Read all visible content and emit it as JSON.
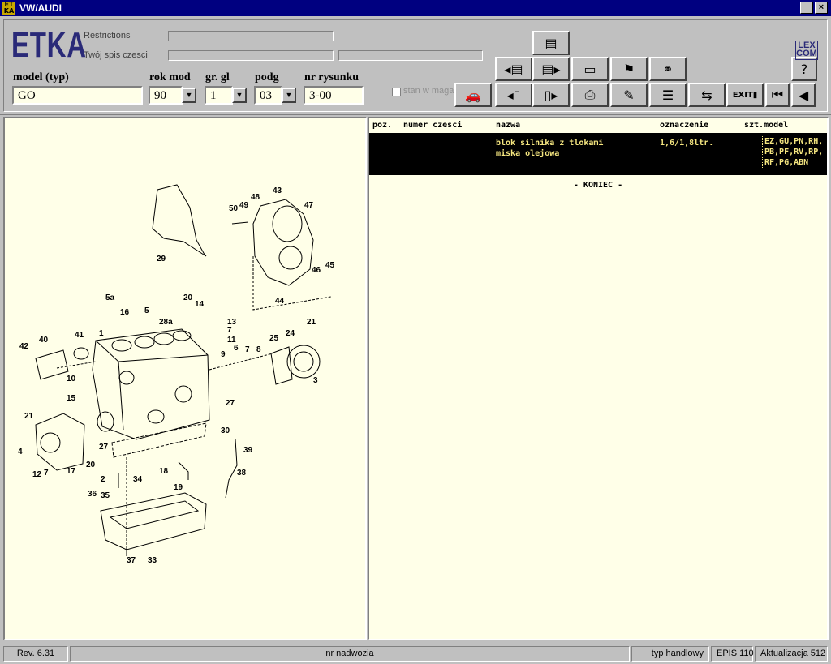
{
  "window": {
    "title": "VW/AUDI",
    "minimize": "_",
    "close": "×"
  },
  "header": {
    "logo": "ETKA",
    "restrictions_label": "Restrictions",
    "parts_list_label": "Twój spis czesci",
    "model_label": "model (typ)",
    "model_value": "GO",
    "year_label": "rok mod",
    "year_value": "90",
    "group_label": "gr. gl",
    "group_value": "1",
    "subgroup_label": "podg",
    "subgroup_value": "03",
    "drawing_label": "nr rysunku",
    "drawing_value": "3-00",
    "stock_checkbox_label": "stan w magaz.",
    "lexcom": "LEX\nCOM",
    "help": "?",
    "exit": "EXIT"
  },
  "table": {
    "headers": {
      "pos": "poz.",
      "part_number": "numer czesci",
      "name": "nazwa",
      "designation": "oznaczenie",
      "qty_model": "szt.model"
    },
    "rows": [
      {
        "name_line1": "blok silnika z tlokami",
        "name_line2": "miska olejowa",
        "designation": "1,6/1,8ltr.",
        "models": "EZ,GU,PN,RH,\nPB,PF,RV,RP,\nRF,PG,ABN"
      }
    ],
    "end_marker": "- KONIEC -"
  },
  "diagram_labels": [
    "43",
    "47",
    "48",
    "49",
    "50",
    "29",
    "45",
    "46",
    "44",
    "5a",
    "16",
    "5",
    "28a",
    "20",
    "14",
    "13",
    "7",
    "11",
    "42",
    "40",
    "41",
    "1",
    "25",
    "24",
    "21",
    "9",
    "6",
    "7",
    "8",
    "3",
    "10",
    "15",
    "27",
    "21",
    "4",
    "12",
    "7",
    "17",
    "20",
    "27",
    "30",
    "39",
    "38",
    "18",
    "19",
    "34",
    "2",
    "36",
    "35",
    "37",
    "33"
  ],
  "status": {
    "rev": "Rev. 6.31",
    "chassis": "nr nadwozia",
    "type": "typ handlowy",
    "epis": "EPIS 110",
    "update": "Aktualizacja 512"
  },
  "colors": {
    "accent": "#000080",
    "logo": "#2a2a78",
    "panel_bg": "#ffffe8",
    "selected_row_text": "#f5e680"
  }
}
